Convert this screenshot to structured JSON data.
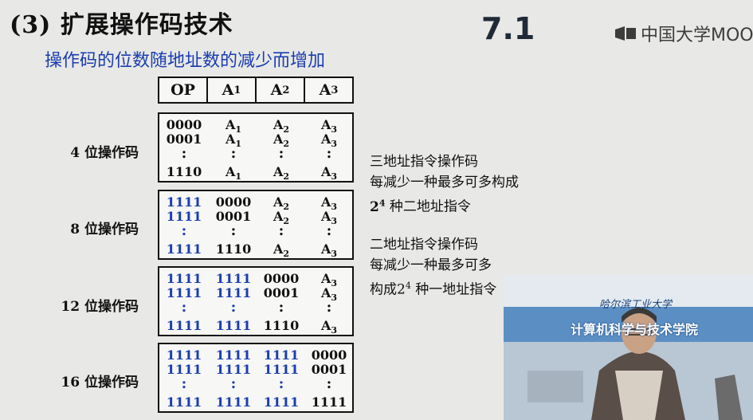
{
  "title": "(3) 扩展操作码技术",
  "subtitle": "操作码的位数随地址数的减少而增加",
  "section_number": "7.1",
  "brand": {
    "name": "中国大学MOOC",
    "icon": "mooc-logo-icon"
  },
  "header": [
    {
      "base": "OP",
      "sub": ""
    },
    {
      "base": "A",
      "sub": "1"
    },
    {
      "base": "A",
      "sub": "2"
    },
    {
      "base": "A",
      "sub": "3"
    }
  ],
  "groups": [
    {
      "label": "4 位操作码",
      "rows": [
        [
          "0000",
          "A|1",
          "A|2",
          "A|3"
        ],
        [
          "0001",
          "A|1",
          "A|2",
          "A|3"
        ],
        [
          ":",
          ":",
          ":",
          ":"
        ],
        [
          "1110",
          "A|1",
          "A|2",
          "A|3"
        ]
      ],
      "blue_cols": []
    },
    {
      "label": "8 位操作码",
      "rows": [
        [
          "1111",
          "0000",
          "A|2",
          "A|3"
        ],
        [
          "1111",
          "0001",
          "A|2",
          "A|3"
        ],
        [
          ":",
          ":",
          ":",
          ":"
        ],
        [
          "1111",
          "1110",
          "A|2",
          "A|3"
        ]
      ],
      "blue_cols": [
        0
      ]
    },
    {
      "label": "12 位操作码",
      "rows": [
        [
          "1111",
          "1111",
          "0000",
          "A|3"
        ],
        [
          "1111",
          "1111",
          "0001",
          "A|3"
        ],
        [
          ":",
          ":",
          ":",
          ":"
        ],
        [
          "1111",
          "1111",
          "1110",
          "A|3"
        ]
      ],
      "blue_cols": [
        0,
        1
      ]
    },
    {
      "label": "16 位操作码",
      "rows": [
        [
          "1111",
          "1111",
          "1111",
          "0000"
        ],
        [
          "1111",
          "1111",
          "1111",
          "0001"
        ],
        [
          ":",
          ":",
          ":",
          ":"
        ],
        [
          "1111",
          "1111",
          "1111",
          "1111"
        ]
      ],
      "blue_cols": [
        0,
        1,
        2
      ]
    }
  ],
  "notes": {
    "note1": {
      "line1": "三地址指令操作码",
      "line2": "每减少一种最多可多构成",
      "line3_pre": "2",
      "line3_sup": "4",
      "line3_post": " 种二地址指令"
    },
    "note2": {
      "line1": "二地址指令操作码",
      "line2": "每减少一种最多可多",
      "line3_pre": "构成2",
      "line3_sup": "4",
      "line3_post": " 种一地址指令"
    }
  },
  "video": {
    "caption": "计算机科学与技术学院",
    "caption_top": "哈尔滨工业大学"
  }
}
